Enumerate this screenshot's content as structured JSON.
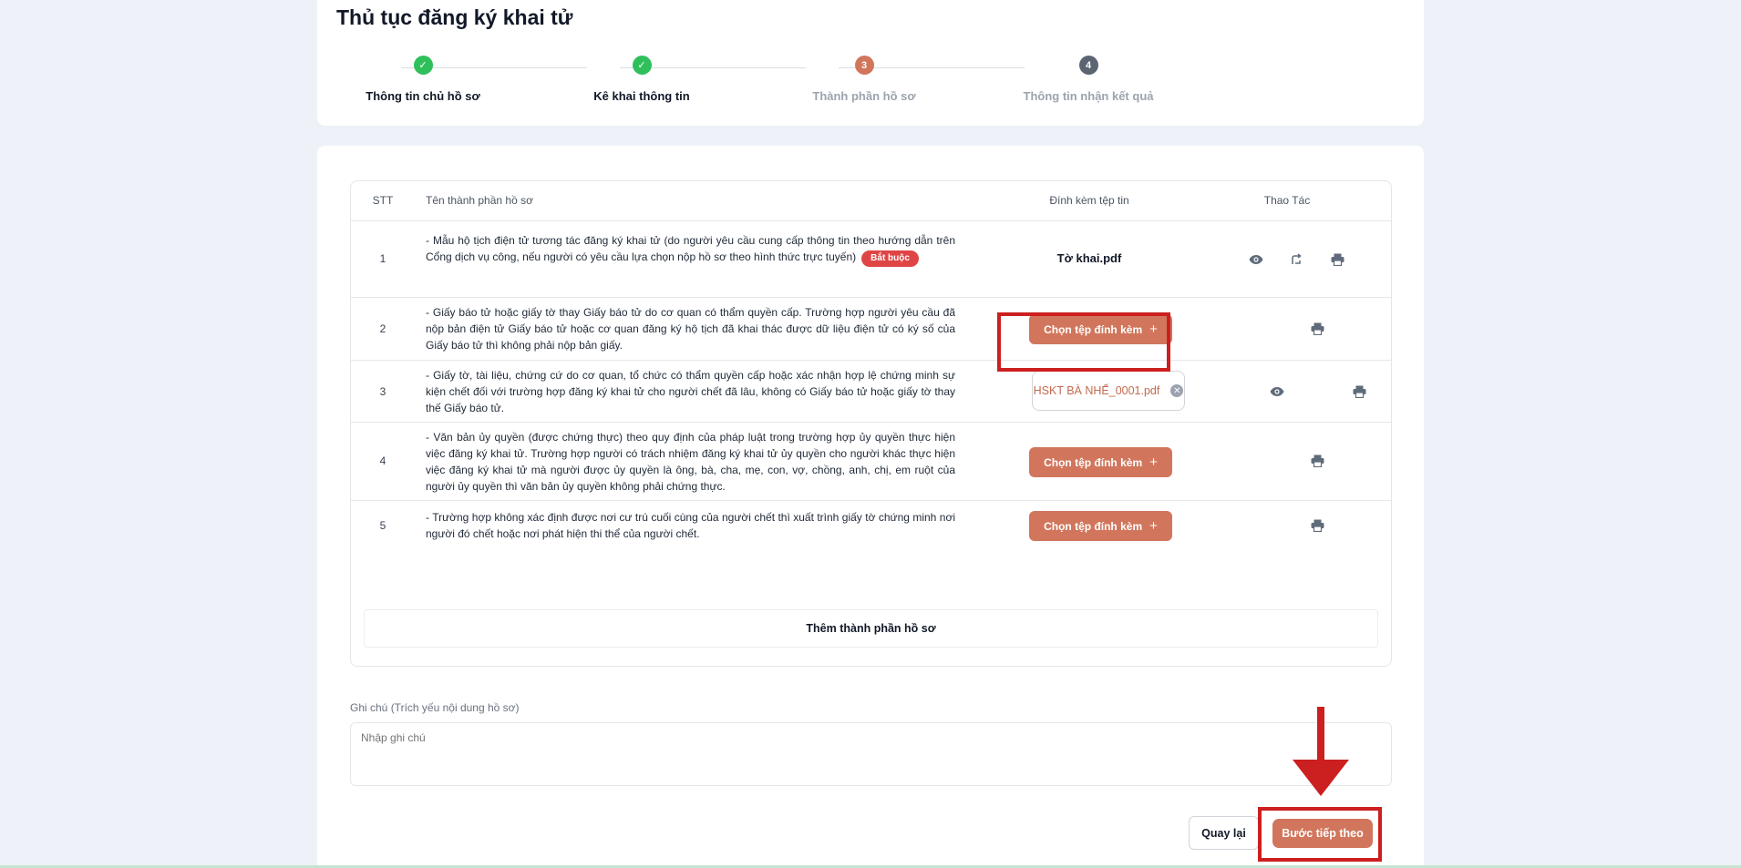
{
  "header": {
    "title": "Thủ tục đăng ký khai tử"
  },
  "steps": [
    {
      "marker": "✓",
      "label": "Thông tin chủ hồ sơ",
      "state": "done"
    },
    {
      "marker": "✓",
      "label": "Kê khai thông tin",
      "state": "done"
    },
    {
      "marker": "3",
      "label": "Thành phần hồ sơ",
      "state": "current"
    },
    {
      "marker": "4",
      "label": "Thông tin nhận kết quả",
      "state": "pending"
    }
  ],
  "table": {
    "headers": {
      "stt": "STT",
      "name": "Tên thành phần hồ sơ",
      "attachment": "Đính kèm tệp tin",
      "actions": "Thao Tác"
    },
    "rows": [
      {
        "stt": "1",
        "name": "- Mẫu hộ tịch điện tử tương tác đăng ký khai tử (do người yêu cầu cung cấp thông tin theo hướng dẫn trên Cổng dịch vụ công, nếu người có yêu cầu lựa chọn nộp hồ sơ theo hình thức trực tuyến)",
        "badge": "Bắt buộc",
        "file": "Tờ khai.pdf"
      },
      {
        "stt": "2",
        "name": "- Giấy báo tử hoặc giấy tờ thay Giấy báo tử do cơ quan có thẩm quyền cấp. Trường hợp người yêu cầu đã nộp bản điện tử Giấy báo tử hoặc cơ quan đăng ký hộ tịch đã khai thác được dữ liệu điện tử có ký số của Giấy báo tử thì không phải nộp bản giấy.",
        "button": "Chọn tệp đính kèm"
      },
      {
        "stt": "3",
        "name": "- Giấy tờ, tài liệu, chứng cứ do cơ quan, tổ chức có thẩm quyền cấp hoặc xác nhận hợp lệ chứng minh sự kiện chết đối với trường hợp đăng ký khai tử cho người chết đã lâu, không có Giấy báo tử hoặc giấy tờ thay thế Giấy báo tử.",
        "file": "HSKT BÀ NHẾ_0001.pdf"
      },
      {
        "stt": "4",
        "name": "- Văn bản ủy quyền (được chứng thực) theo quy định của pháp luật trong trường hợp ủy quyền thực hiện việc đăng ký khai tử. Trường hợp người có trách nhiệm đăng ký khai tử ủy quyền cho người khác thực hiện việc đăng ký khai tử mà người được ủy quyền là ông, bà, cha, mẹ, con, vợ, chồng, anh, chị, em ruột của người ủy quyền thì văn bản ủy quyền không phải chứng thực.",
        "button": "Chọn tệp đính kèm"
      },
      {
        "stt": "5",
        "name": "- Trường hợp không xác định được nơi cư trú cuối cùng của người chết thì xuất trình giấy tờ chứng minh nơi người đó chết hoặc nơi phát hiện thi thể của người chết.",
        "button": "Chọn tệp đính kèm"
      }
    ],
    "add_label": "Thêm thành phần hồ sơ"
  },
  "note": {
    "label": "Ghi chú (Trích yếu nội dung hồ sơ)",
    "placeholder": "Nhập ghi chú",
    "value": ""
  },
  "footer": {
    "back_label": "Quay lại",
    "next_label": "Bước tiếp theo"
  },
  "icons": {
    "view": "eye-icon",
    "replace": "replace-icon",
    "print": "printer-icon",
    "remove": "close-circle-icon",
    "add": "plus-icon"
  },
  "colors": {
    "accent": "#d1765c",
    "done": "#2fc05c",
    "current": "#d1765c",
    "pending": "#5b6470",
    "required": "#e04545",
    "highlight": "#cc1f1f"
  }
}
